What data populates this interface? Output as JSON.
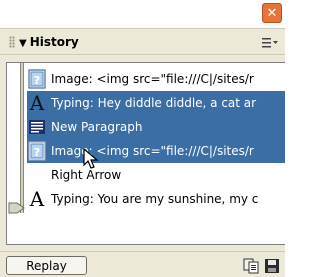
{
  "panel": {
    "close_glyph": "✕",
    "title": "History",
    "collapse_glyph": "▼",
    "options_icon": "panel-options-icon"
  },
  "history": {
    "items": [
      {
        "icon": "image-icon",
        "label": "Image: <img src=\"file:///C|/sites/r",
        "selected": false
      },
      {
        "icon": "typing-icon",
        "icon_glyph": "A",
        "label": "Typing: Hey diddle diddle, a cat ar",
        "selected": true
      },
      {
        "icon": "paragraph-icon",
        "label": "New Paragraph",
        "selected": true
      },
      {
        "icon": "image-icon",
        "label": "Image: <img src=\"file:///C|/sites/r",
        "selected": true
      },
      {
        "icon": "",
        "label": "Right Arrow",
        "selected": false
      },
      {
        "icon": "typing-icon",
        "icon_glyph": "A",
        "label": "Typing: You are my sunshine, my c",
        "selected": false
      }
    ]
  },
  "footer": {
    "replay_label": "Replay",
    "copy_icon": "copy-steps-icon",
    "save_icon": "save-as-command-icon"
  },
  "colors": {
    "selection": "#3a6ea5",
    "panel_bg": "#ece9d8",
    "close": "#e8733a"
  }
}
